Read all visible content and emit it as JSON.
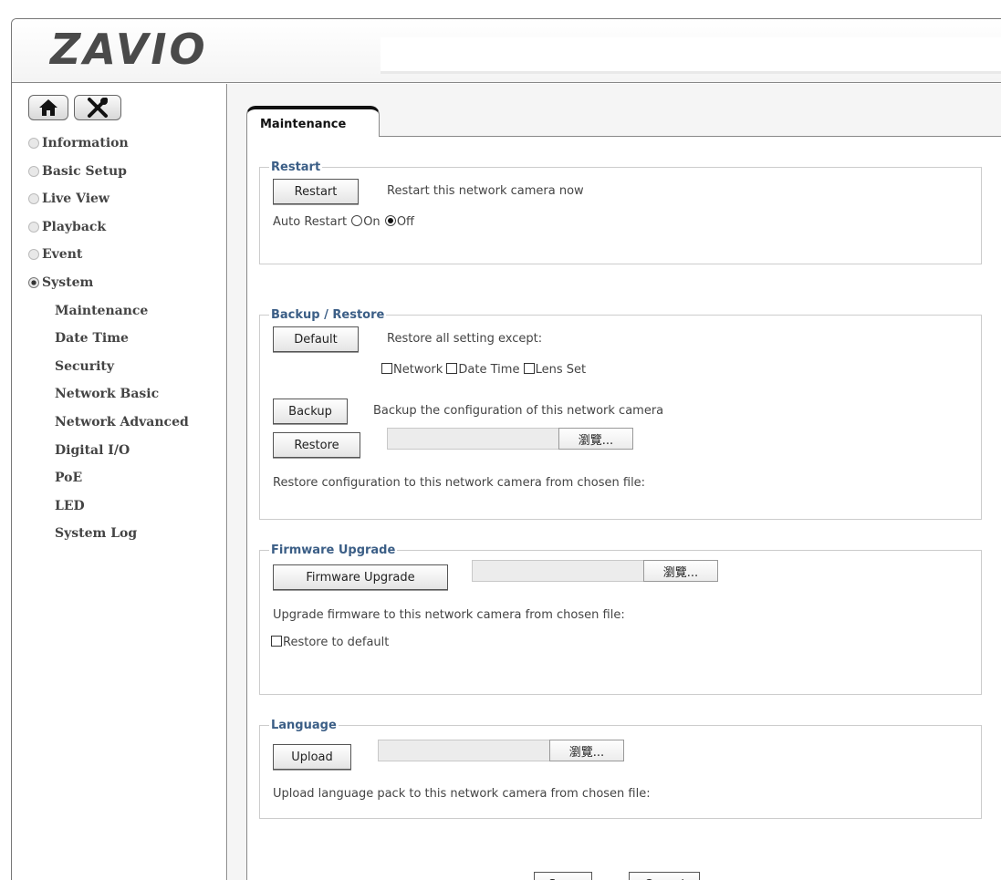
{
  "header": {
    "logo_text": "ZAVIO"
  },
  "sidebar": {
    "home_icon": "home-icon",
    "tools_icon": "tools-icon",
    "items": [
      {
        "label": "Information",
        "expanded": false
      },
      {
        "label": "Basic Setup",
        "expanded": false
      },
      {
        "label": "Live View",
        "expanded": false
      },
      {
        "label": "Playback",
        "expanded": false
      },
      {
        "label": "Event",
        "expanded": false
      },
      {
        "label": "System",
        "expanded": true
      }
    ],
    "subitems": [
      "Maintenance",
      "Date Time",
      "Security",
      "Network Basic",
      "Network Advanced",
      "Digital I/O",
      "PoE",
      "LED",
      "System Log"
    ]
  },
  "main": {
    "tab_label": "Maintenance",
    "restart": {
      "legend": "Restart",
      "button": "Restart",
      "description": "Restart this network camera now",
      "auto_label": "Auto Restart",
      "on_label": "On",
      "off_label": "Off",
      "selected": "Off"
    },
    "backup": {
      "legend": "Backup / Restore",
      "default_button": "Default",
      "default_desc": "Restore all setting except:",
      "checkboxes": [
        "Network",
        "Date Time",
        "Lens Set"
      ],
      "backup_button": "Backup",
      "backup_desc": "Backup the configuration of this network camera",
      "restore_button": "Restore",
      "browse_label": "瀏覽...",
      "restore_desc": "Restore configuration to this network camera from chosen file:"
    },
    "firmware": {
      "legend": "Firmware Upgrade",
      "button": "Firmware Upgrade",
      "browse_label": "瀏覽...",
      "desc": "Upgrade firmware to this network camera from chosen file:",
      "checkbox_label": "Restore to default"
    },
    "language": {
      "legend": "Language",
      "button": "Upload",
      "browse_label": "瀏覽...",
      "desc": "Upload language pack to this network camera from chosen file:"
    },
    "save_label": "Save",
    "cancel_label": "Cancel"
  }
}
